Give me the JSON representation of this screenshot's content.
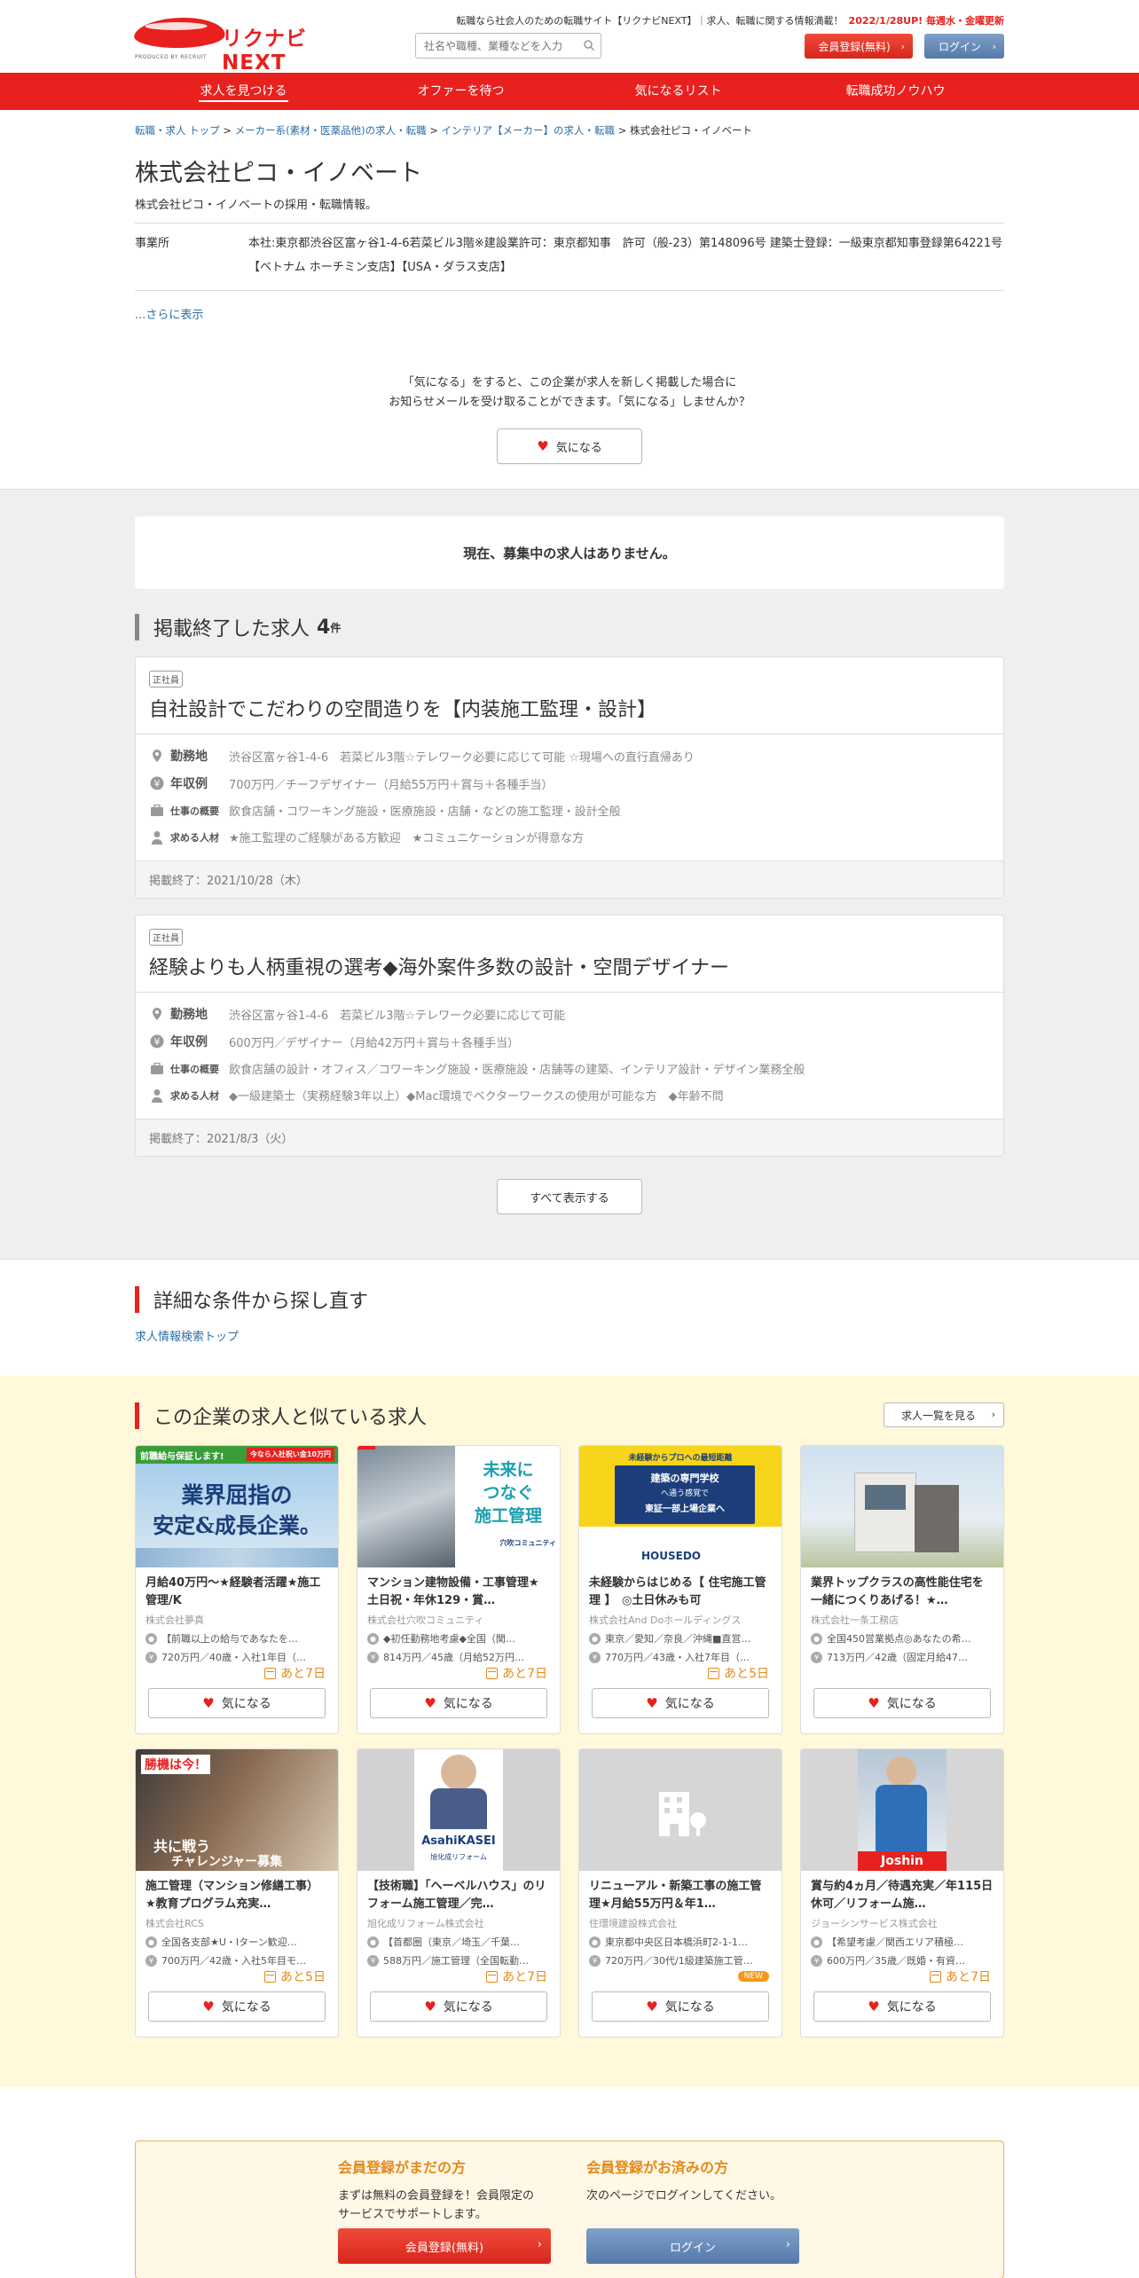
{
  "header": {
    "logo_text": "リクナビNEXT",
    "logo_by": "PRODUCED BY RECRUIT",
    "tagline": "転職なら社会人のための転職サイト【リクナビNEXT】｜求人、転職に関する情報満載！",
    "update_note": "2022/1/28UP! 毎週水・金曜更新",
    "search_placeholder": "社名や職種、業種などを入力",
    "register_label": "会員登録(無料)",
    "login_label": "ログイン"
  },
  "nav": [
    "求人を見つける",
    "オファーを待つ",
    "気になるリスト",
    "転職成功ノウハウ"
  ],
  "breadcrumb": {
    "items": [
      "転職・求人 トップ",
      "メーカー系(素材・医薬品他)の求人・転職",
      "インテリア【メーカー】の求人・転職"
    ],
    "current": "株式会社ピコ・イノベート",
    "sep": " > "
  },
  "company": {
    "name": "株式会社ピコ・イノベート",
    "sub": "株式会社ピコ・イノベートの採用・転職情報。",
    "office_label": "事業所",
    "office_value": "本社:東京都渋谷区富ヶ谷1-4-6若菜ビル3階※建設業許可：東京都知事　許可（般-23）第148096号 建築士登録：一級東京都知事登録第64221号【ベトナム ホーチミン支店】【USA・ダラス支店】",
    "more": "...さらに表示"
  },
  "favorite": {
    "msg1": "「気になる」をすると、この企業が求人を新しく掲載した場合に",
    "msg2": "お知らせメールを受け取ることができます。「気になる」しませんか？",
    "button": "気になる"
  },
  "jobs": {
    "no_jobs": "現在、募集中の求人はありません。",
    "ended_title": "掲載終了した求人",
    "ended_count": "4",
    "ended_unit": "件",
    "labels": {
      "location": "勤務地",
      "salary": "年収例",
      "overview": "仕事の概要",
      "seeking": "求める人材"
    },
    "items": [
      {
        "tag": "正社員",
        "title": "自社設計でこだわりの空間造りを【内装施工監理・設計】",
        "location": "渋谷区富ヶ谷1-4-6　若菜ビル3階☆テレワーク必要に応じて可能 ☆現場への直行直帰あり",
        "salary": "700万円／チーフデザイナー（月給55万円＋賞与＋各種手当）",
        "overview": "飲食店舗・コワーキング施設・医療施設・店舗・などの施工監理・設計全般",
        "seeking": "★施工監理のご経験がある方歓迎　★コミュニケーションが得意な方",
        "ended": "掲載終了：2021/10/28（木）"
      },
      {
        "tag": "正社員",
        "title": "経験よりも人柄重視の選考◆海外案件多数の設計・空間デザイナー",
        "location": "渋谷区富ヶ谷1-4-6　若菜ビル3階☆テレワーク必要に応じて可能",
        "salary": "600万円／デザイナー（月給42万円＋賞与＋各種手当）",
        "overview": "飲食店舗の設計・オフィス／コワーキング施設・医療施設・店舗等の建築、インテリア設計・デザイン業務全般",
        "seeking": "◆一級建築士（実務経験3年以上）◆Mac環境でベクターワークスの使用が可能な方　◆年齢不問",
        "ended": "掲載終了：2021/8/3（火）"
      }
    ],
    "show_all": "すべて表示する"
  },
  "search_again": {
    "title": "詳細な条件から探し直す",
    "link": "求人情報検索トップ"
  },
  "similar": {
    "title": "この企業の求人と似ている求人",
    "view_list": "求人一覧を見る",
    "fav_label": "気になる",
    "cards": [
      {
        "title": "月給40万円～★経験者活躍★施工管理/K",
        "company": "株式会社夢真",
        "loc": "【前職以上の給与であなたを…",
        "sal": "720万円／40歳・入社1年目（…",
        "deadline": "あと7日",
        "img_banner": "前職給与保証します!",
        "img_b2": "今なら入社祝い金10万円",
        "img_l1": "業界屈指の",
        "img_l2": "安定&成長企業。"
      },
      {
        "title": "マンション建物設備・工事管理★土日祝・年休129・賞…",
        "company": "株式会社穴吹コミュニティ",
        "loc": "◆初任勤務地考慮◆全国（関…",
        "sal": "814万円／45歳（月給52万円…",
        "deadline": "あと7日",
        "img_l1": "未来に",
        "img_l2": "つなぐ",
        "img_l3": "施工管理",
        "img_logo": "穴吹コミュニティ"
      },
      {
        "title": "未経験からはじめる【 住宅施工管理 】　◎土日休みも可",
        "company": "株式会社And Doホールディングス",
        "loc": "東京／愛知／奈良／沖縄■直営…",
        "sal": "770万円／43歳・入社7年目（…",
        "deadline": "あと5日",
        "img_banner": "未経験からプロへの最短距離",
        "img_l1": "建築の専門学校",
        "img_l2": "へ通う感覚で",
        "img_l3": "東証一部上場企業へ",
        "img_logo": "HOUSEDO"
      },
      {
        "title": "業界トップクラスの高性能住宅を一緒につくりあげる！★…",
        "company": "株式会社一条工務店",
        "loc": "全国450営業拠点◎あなたの希…",
        "sal": "713万円／42歳（固定月給47…",
        "deadline": "あと7日"
      },
      {
        "title": "施工管理（マンション修繕工事）★教育プログラム充実…",
        "company": "株式会社RCS",
        "loc": "全国各支部★U・Iターン歓迎…",
        "sal": "700万円／42歳・入社5年目モ…",
        "deadline": "あと5日",
        "img_l1": "勝機は今！",
        "img_l2": "共に戦う",
        "img_l3": "チャレンジャー募集"
      },
      {
        "title": "【技術職】「ヘーベルハウス」のリフォーム施工管理／完…",
        "company": "旭化成リフォーム株式会社",
        "loc": "【首都圏（東京／埼玉／千葉…",
        "sal": "588万円／施工管理（全国転勤…",
        "deadline": "あと7日",
        "img_logo": "AsahiKASEI",
        "img_logo2": "旭化成リフォーム"
      },
      {
        "title": "リニューアル・新築工事の施工管理★月給55万円＆年1…",
        "company": "住環境建設株式会社",
        "loc": "東京都中央区日本橋浜町2-1-1…",
        "sal": "720万円／30代/1級建築施工管…",
        "badge": "NEW"
      },
      {
        "title": "賞与約4ヵ月／待遇充実／年115日休可／リフォーム施…",
        "company": "ジョーシンサービス株式会社",
        "loc": "【希望考慮／関西エリア積極…",
        "sal": "600万円／35歳／既婚・有資…",
        "deadline": "あと7日",
        "img_logo": "Joshin"
      }
    ]
  },
  "register_box": {
    "not_yet_title": "会員登録がまだの方",
    "not_yet_text1": "まずは無料の会員登録を！会員限定の",
    "not_yet_text2": "サービスでサポートします。",
    "not_yet_button": "会員登録(無料)",
    "done_title": "会員登録がお済みの方",
    "done_text": "次のページでログインしてください。",
    "done_button": "ログイン"
  },
  "colors": {
    "brand_red": "#e8211f",
    "link_blue": "#2d6ea8",
    "login_blue": "#5479aa",
    "deadline_orange": "#e48a1b",
    "similar_bg": "#fff8da"
  },
  "icons": [
    "search-icon",
    "chevron-right-icon",
    "heart-icon",
    "pin-icon",
    "yen-icon",
    "briefcase-icon",
    "person-icon",
    "calendar-icon",
    "building-icon"
  ]
}
